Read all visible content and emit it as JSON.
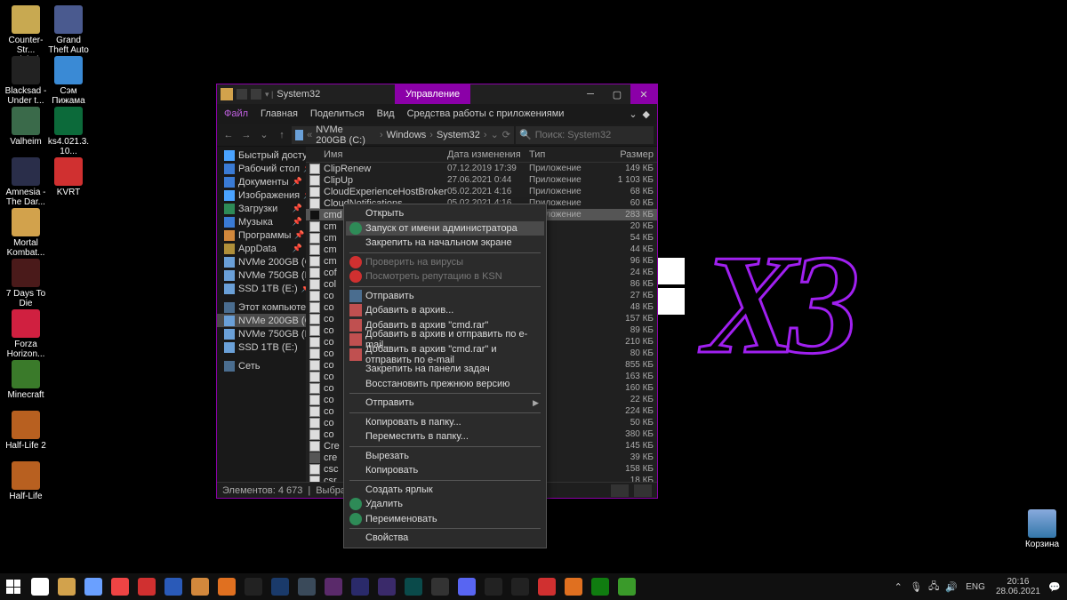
{
  "desktop_icons": {
    "left_col1": [
      {
        "label": "Counter-Str... Global Offe...",
        "color": "#c8a951"
      },
      {
        "label": "Blacksad - Under t...",
        "color": "#222"
      },
      {
        "label": "Valheim",
        "color": "#3a6a4a"
      },
      {
        "label": "Amnesia - The Dar...",
        "color": "#2a2e4a"
      },
      {
        "label": "Mortal Kombat...",
        "color": "#d2a24c"
      },
      {
        "label": "7 Days To Die",
        "color": "#4a1a1a"
      },
      {
        "label": "Forza Horizon...",
        "color": "#d02040"
      },
      {
        "label": "Minecraft",
        "color": "#3a7a2a"
      },
      {
        "label": "Half-Life 2",
        "color": "#b86020"
      },
      {
        "label": "Half-Life",
        "color": "#b86020"
      }
    ],
    "left_col2": [
      {
        "label": "Grand Theft Auto IV",
        "color": "#4a5a8f"
      },
      {
        "label": "Сэм Пижама",
        "color": "#3a8ad5"
      },
      {
        "label": "ks4.021.3.10...",
        "color": "#0c6a3a"
      },
      {
        "label": "KVRT",
        "color": "#d03030"
      }
    ],
    "recycle": "Корзина"
  },
  "explorer": {
    "title": "System32",
    "title_tab": "Управление",
    "ribbon": {
      "file": "Файл",
      "tabs": [
        "Главная",
        "Поделиться",
        "Вид",
        "Средства работы с приложениями"
      ]
    },
    "breadcrumb": [
      "NVMe 200GB (C:)",
      "Windows",
      "System32"
    ],
    "search_placeholder": "Поиск: System32",
    "columns": {
      "name": "Имя",
      "date": "Дата изменения",
      "type": "Тип",
      "size": "Размер"
    },
    "tree": [
      {
        "icon": "ic-star",
        "label": "Быстрый доступ"
      },
      {
        "icon": "ic-desk",
        "label": "Рабочий стол",
        "pin": true
      },
      {
        "icon": "ic-doc",
        "label": "Документы",
        "pin": true
      },
      {
        "icon": "ic-img",
        "label": "Изображения",
        "pin": true
      },
      {
        "icon": "ic-dl",
        "label": "Загрузки",
        "pin": true
      },
      {
        "icon": "ic-music",
        "label": "Музыка",
        "pin": true
      },
      {
        "icon": "ic-prog",
        "label": "Программы",
        "pin": true
      },
      {
        "icon": "ic-app",
        "label": "AppData",
        "pin": true
      },
      {
        "icon": "ic-drive",
        "label": "NVMe 200GB (C:)",
        "pin": true
      },
      {
        "icon": "ic-drive",
        "label": "NVMe 750GB (D:)",
        "pin": true
      },
      {
        "icon": "ic-drive",
        "label": "SSD 1TB (E:)",
        "pin": true
      },
      {
        "spacer": true
      },
      {
        "icon": "ic-pc",
        "label": "Этот компьютер"
      },
      {
        "icon": "ic-drive",
        "label": "NVMe 200GB (C:)",
        "sel": true
      },
      {
        "icon": "ic-drive",
        "label": "NVMe 750GB (D:)"
      },
      {
        "icon": "ic-drive",
        "label": "SSD 1TB (E:)"
      },
      {
        "spacer": true
      },
      {
        "icon": "ic-net",
        "label": "Сеть"
      }
    ],
    "rows": [
      {
        "ico": "ic-exe",
        "name": "ClipRenew",
        "date": "07.12.2019 17:39",
        "type": "Приложение",
        "size": "149 КБ"
      },
      {
        "ico": "ic-exe",
        "name": "ClipUp",
        "date": "27.06.2021 0:44",
        "type": "Приложение",
        "size": "1 103 КБ"
      },
      {
        "ico": "ic-exe",
        "name": "CloudExperienceHostBroker",
        "date": "05.02.2021 4:16",
        "type": "Приложение",
        "size": "68 КБ"
      },
      {
        "ico": "ic-exe",
        "name": "CloudNotifications",
        "date": "05.02.2021 4:16",
        "type": "Приложение",
        "size": "60 КБ"
      },
      {
        "ico": "ic-cmd",
        "name": "cmd",
        "date": "05.02.2021 4:16",
        "type": "Приложение",
        "size": "283 КБ",
        "sel": true
      },
      {
        "ico": "ic-exe",
        "name": "cm",
        "trunc": true,
        "type": "ложение",
        "size": "20 КБ"
      },
      {
        "ico": "ic-exe",
        "name": "cm",
        "trunc": true,
        "type": "ложение",
        "size": "54 КБ"
      },
      {
        "ico": "ic-exe",
        "name": "cm",
        "trunc": true,
        "type": "ложение",
        "size": "44 КБ"
      },
      {
        "ico": "ic-exe",
        "name": "cm",
        "trunc": true,
        "type": "ложение",
        "size": "96 КБ"
      },
      {
        "ico": "ic-exe",
        "name": "cof",
        "trunc": true,
        "type": "ложение",
        "size": "24 КБ"
      },
      {
        "ico": "ic-exe",
        "name": "col",
        "trunc": true,
        "type": "ложение",
        "size": "86 КБ"
      },
      {
        "ico": "ic-exe",
        "name": "co",
        "trunc": true,
        "type": "ложение",
        "size": "27 КБ"
      },
      {
        "ico": "ic-exe",
        "name": "co",
        "trunc": true,
        "type": "ложение",
        "size": "48 КБ"
      },
      {
        "ico": "ic-exe",
        "name": "co",
        "trunc": true,
        "type": "ложение",
        "size": "157 КБ"
      },
      {
        "ico": "ic-exe",
        "name": "co",
        "trunc": true,
        "type": "ложение",
        "size": "89 КБ"
      },
      {
        "ico": "ic-exe",
        "name": "co",
        "trunc": true,
        "type": "ложение",
        "size": "210 КБ"
      },
      {
        "ico": "ic-exe",
        "name": "co",
        "trunc": true,
        "type": "ложение",
        "size": "80 КБ"
      },
      {
        "ico": "ic-exe",
        "name": "co",
        "trunc": true,
        "type": "ложение",
        "size": "855 КБ"
      },
      {
        "ico": "ic-exe",
        "name": "co",
        "trunc": true,
        "type": "ложение",
        "size": "163 КБ"
      },
      {
        "ico": "ic-exe",
        "name": "co",
        "trunc": true,
        "type": "ложение",
        "size": "160 КБ"
      },
      {
        "ico": "ic-exe",
        "name": "co",
        "trunc": true,
        "type": "ложение",
        "size": "22 КБ"
      },
      {
        "ico": "ic-exe",
        "name": "co",
        "trunc": true,
        "type": "ложение",
        "size": "224 КБ"
      },
      {
        "ico": "ic-exe",
        "name": "co",
        "trunc": true,
        "type": "ложение",
        "size": "50 КБ"
      },
      {
        "ico": "ic-exe",
        "name": "co",
        "trunc": true,
        "type": "ложение",
        "size": "380 КБ"
      },
      {
        "ico": "ic-exe",
        "name": "Cre",
        "trunc": true,
        "type": "ложение",
        "size": "145 КБ"
      },
      {
        "ico": "ic-unknown",
        "name": "cre",
        "trunc": true,
        "type": "ложение",
        "size": "39 КБ"
      },
      {
        "ico": "ic-exe",
        "name": "csc",
        "trunc": true,
        "type": "ложение",
        "size": "158 КБ"
      },
      {
        "ico": "ic-exe",
        "name": "csr",
        "trunc": true,
        "type": "ложение",
        "size": "18 КБ"
      }
    ],
    "status": {
      "count": "Элементов: 4 673",
      "sel": "Выбран 1 элемент: 283 КБ"
    }
  },
  "context_menu": [
    {
      "label": "Открыть"
    },
    {
      "label": "Запуск от имени администратора",
      "icon": "ic-shield",
      "hl": true
    },
    {
      "label": "Закрепить на начальном экране"
    },
    {
      "sep": true
    },
    {
      "label": "Проверить на вирусы",
      "icon": "ic-kav",
      "dis": true
    },
    {
      "label": "Посмотреть репутацию в KSN",
      "icon": "ic-kav",
      "dis": true
    },
    {
      "sep": true
    },
    {
      "label": "Отправить",
      "icon": "ic-pin"
    },
    {
      "label": "Добавить в архив...",
      "icon": "ic-zip"
    },
    {
      "label": "Добавить в архив \"cmd.rar\"",
      "icon": "ic-zip"
    },
    {
      "label": "Добавить в архив и отправить по e-mail...",
      "icon": "ic-zip"
    },
    {
      "label": "Добавить в архив \"cmd.rar\" и отправить по e-mail",
      "icon": "ic-zip"
    },
    {
      "label": "Закрепить на панели задач"
    },
    {
      "label": "Восстановить прежнюю версию"
    },
    {
      "sep": true
    },
    {
      "label": "Отправить",
      "arrow": true
    },
    {
      "sep": true
    },
    {
      "label": "Копировать в папку..."
    },
    {
      "label": "Переместить в папку..."
    },
    {
      "sep": true
    },
    {
      "label": "Вырезать"
    },
    {
      "label": "Копировать"
    },
    {
      "sep": true
    },
    {
      "label": "Создать ярлык"
    },
    {
      "label": "Удалить",
      "icon": "ic-shield"
    },
    {
      "label": "Переименовать",
      "icon": "ic-shield"
    },
    {
      "sep": true
    },
    {
      "label": "Свойства"
    }
  ],
  "taskbar": {
    "apps": [
      {
        "name": "start",
        "color": "#fff"
      },
      {
        "name": "search",
        "color": "#fff"
      },
      {
        "name": "explorer",
        "color": "#d2a24c"
      },
      {
        "name": "notepad",
        "color": "#6aa0ff"
      },
      {
        "name": "chrome",
        "color": "#e44"
      },
      {
        "name": "yandex",
        "color": "#d03030"
      },
      {
        "name": "word",
        "color": "#2a5ab8"
      },
      {
        "name": "aimp",
        "color": "#d2883c"
      },
      {
        "name": "vlc",
        "color": "#e07020"
      },
      {
        "name": "cmd",
        "color": "#222"
      },
      {
        "name": "ps",
        "color": "#1a3a6a"
      },
      {
        "name": "sublime",
        "color": "#3a4a5a"
      },
      {
        "name": "pr",
        "color": "#5a2a6a"
      },
      {
        "name": "ae",
        "color": "#2a2a6a"
      },
      {
        "name": "me",
        "color": "#3a2a6a"
      },
      {
        "name": "au",
        "color": "#0a4a4a"
      },
      {
        "name": "obs",
        "color": "#333"
      },
      {
        "name": "discord",
        "color": "#5865f2"
      },
      {
        "name": "steam",
        "color": "#222"
      },
      {
        "name": "epic",
        "color": "#222"
      },
      {
        "name": "opera",
        "color": "#d03030"
      },
      {
        "name": "brave",
        "color": "#e07020"
      },
      {
        "name": "xbox",
        "color": "#107c10"
      },
      {
        "name": "utorrent",
        "color": "#3a9a2a"
      }
    ],
    "lang": "ENG",
    "time": "20:16",
    "date": "28.06.2021"
  }
}
